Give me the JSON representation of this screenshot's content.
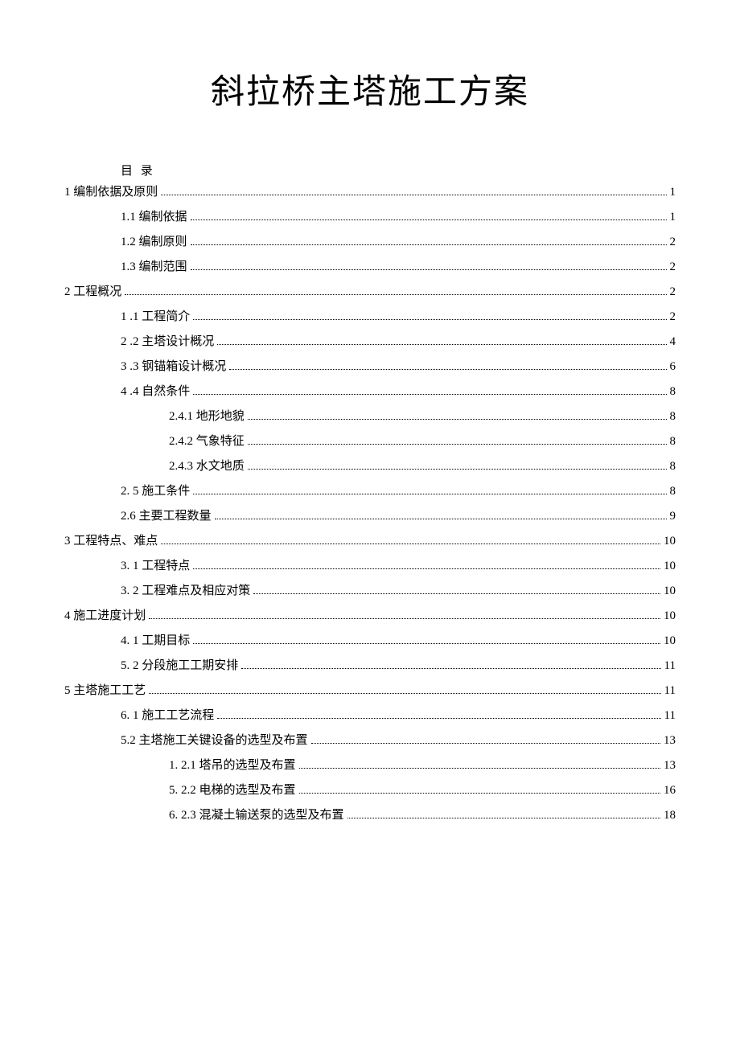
{
  "title": "斜拉桥主塔施工方案",
  "toc_header": "目 录",
  "toc": [
    {
      "label": "1 编制依据及原则",
      "page": "1",
      "indent": 0
    },
    {
      "label": "1.1 编制依据 ",
      "page": "1",
      "indent": 1
    },
    {
      "label": "1.2  编制原则 ",
      "page": "2",
      "indent": 1
    },
    {
      "label": "1.3  编制范围 ",
      "page": "2",
      "indent": 1
    },
    {
      "label": "2 工程概况",
      "page": "2",
      "indent": 0
    },
    {
      "label": "1  .1 工程简介",
      "page": "2",
      "indent": 1
    },
    {
      "label": "2  .2 主塔设计概况",
      "page": "4",
      "indent": 1
    },
    {
      "label": "3  .3 钢锚箱设计概况",
      "page": "6",
      "indent": 1
    },
    {
      "label": "4  .4 自然条件",
      "page": "8",
      "indent": 1
    },
    {
      "label": "2.4.1 地形地貌",
      "page": "8",
      "indent": 2
    },
    {
      "label": "2.4.2 气象特征",
      "page": "8",
      "indent": 2
    },
    {
      "label": "2.4.3 水文地质",
      "page": "8",
      "indent": 2
    },
    {
      "label": "2. 5 施工条件 ",
      "page": "8",
      "indent": 1
    },
    {
      "label": "2.6 主要工程数量 ",
      "page": "9",
      "indent": 1
    },
    {
      "label": "3 工程特点、难点",
      "page": "10",
      "indent": 0
    },
    {
      "label": "3. 1 工程特点 ",
      "page": "10",
      "indent": 1
    },
    {
      "label": "3. 2 工程难点及相应对策 ",
      "page": "10",
      "indent": 1
    },
    {
      "label": "4 施工进度计划",
      "page": "10",
      "indent": 0
    },
    {
      "label": "4. 1 工期目标 ",
      "page": "10",
      "indent": 1
    },
    {
      "label": "5. 2 分段施工工期安排 ",
      "page": "11",
      "indent": 1
    },
    {
      "label": "5 主塔施工工艺",
      "page": "11",
      "indent": 0
    },
    {
      "label": "6. 1 施工工艺流程 ",
      "page": "11",
      "indent": 1
    },
    {
      "label": "5.2 主塔施工关键设备的选型及布置 ",
      "page": "13",
      "indent": 1
    },
    {
      "label": "1. 2.1 塔吊的选型及布置",
      "page": "13",
      "indent": 2
    },
    {
      "label": "5. 2.2 电梯的选型及布置",
      "page": "16",
      "indent": 2
    },
    {
      "label": "6. 2.3 混凝土输送泵的选型及布置",
      "page": "18",
      "indent": 2
    }
  ]
}
